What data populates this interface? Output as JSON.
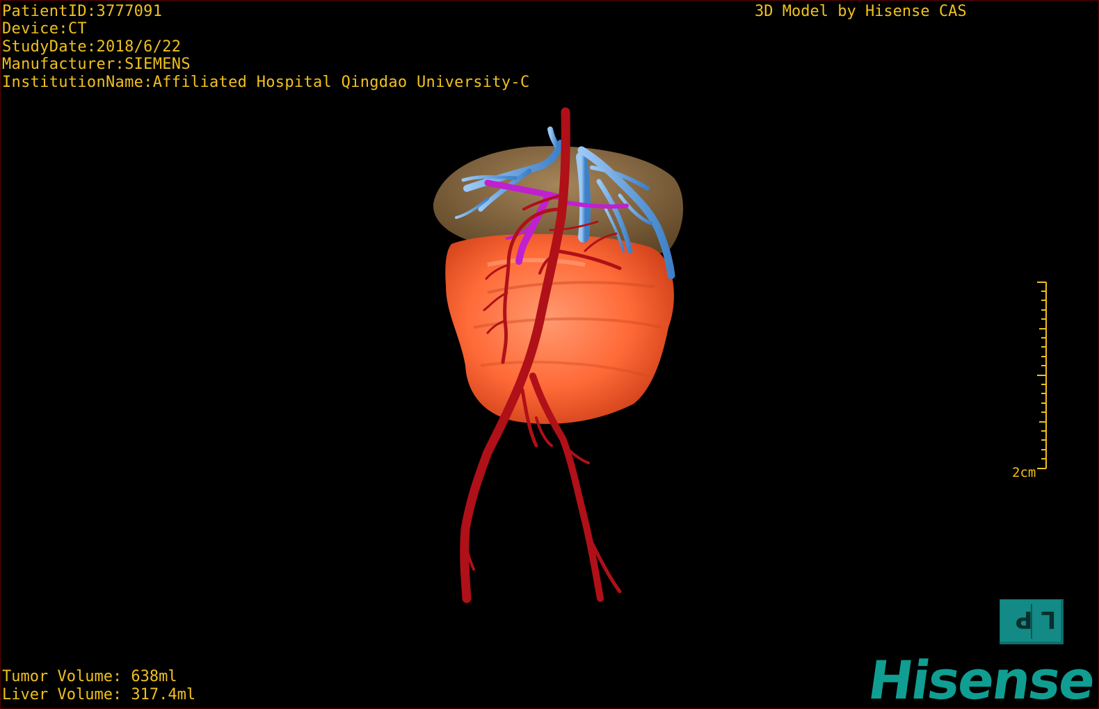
{
  "window": {
    "accent_text_color": "#f0c020",
    "background_color": "#000000"
  },
  "patient_info": {
    "patient_id": "PatientID:3777091",
    "device": "Device:CT",
    "study_date": "StudyDate:2018/6/22",
    "manufacturer": "Manufacturer:SIEMENS",
    "institution": "InstitutionName:Affiliated Hospital Qingdao University-C"
  },
  "watermark": "3D Model by Hisense CAS",
  "scale_bar": {
    "label": "2cm"
  },
  "volumes": {
    "tumor": "Tumor Volume: 638ml",
    "liver": "Liver Volume: 317.4ml"
  },
  "orientation_cube": {
    "face_label": "LP",
    "color": "#138a85"
  },
  "logo": {
    "text": "Hisense",
    "color": "#109e92"
  },
  "render_colors": {
    "liver": "#8a6a3c",
    "tumor": "#ff6030",
    "artery": "#b01018",
    "portal_vein": "#c020d0",
    "hepatic_vein": "#5aa0e6"
  }
}
